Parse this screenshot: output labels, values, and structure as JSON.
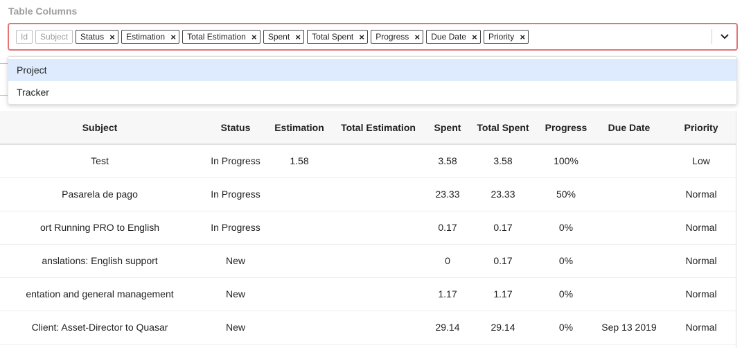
{
  "field": {
    "label": "Table Columns"
  },
  "selected_columns": [
    {
      "label": "Id",
      "removable": false
    },
    {
      "label": "Subject",
      "removable": false
    },
    {
      "label": "Status",
      "removable": true
    },
    {
      "label": "Estimation",
      "removable": true
    },
    {
      "label": "Total Estimation",
      "removable": true
    },
    {
      "label": "Spent",
      "removable": true
    },
    {
      "label": "Total Spent",
      "removable": true
    },
    {
      "label": "Progress",
      "removable": true
    },
    {
      "label": "Due Date",
      "removable": true
    },
    {
      "label": "Priority",
      "removable": true
    }
  ],
  "remove_glyph": "×",
  "dropdown_options": [
    "Project",
    "Tracker"
  ],
  "table": {
    "headers": [
      "Subject",
      "Status",
      "Estimation",
      "Total Estimation",
      "Spent",
      "Total Spent",
      "Progress",
      "Due Date",
      "Priority"
    ],
    "rows": [
      [
        "Test",
        "In Progress",
        "1.58",
        "",
        "3.58",
        "3.58",
        "100%",
        "",
        "Low"
      ],
      [
        "Pasarela de pago",
        "In Progress",
        "",
        "",
        "23.33",
        "23.33",
        "50%",
        "",
        "Normal"
      ],
      [
        "ort Running PRO to English",
        "In Progress",
        "",
        "",
        "0.17",
        "0.17",
        "0%",
        "",
        "Normal"
      ],
      [
        "anslations: English support",
        "New",
        "",
        "",
        "0",
        "0.17",
        "0%",
        "",
        "Normal"
      ],
      [
        "entation and general management",
        "New",
        "",
        "",
        "1.17",
        "1.17",
        "0%",
        "",
        "Normal"
      ],
      [
        "Client: Asset-Director to Quasar",
        "New",
        "",
        "",
        "29.14",
        "29.14",
        "0%",
        "Sep 13 2019",
        "Normal"
      ]
    ]
  },
  "colors": {
    "error_border": "#e57373",
    "option_highlight": "#deebff",
    "label_gray": "#9e9e9e"
  },
  "icons": {
    "dropdown_toggle": "chevron-down-icon",
    "chip_remove": "close-icon"
  }
}
